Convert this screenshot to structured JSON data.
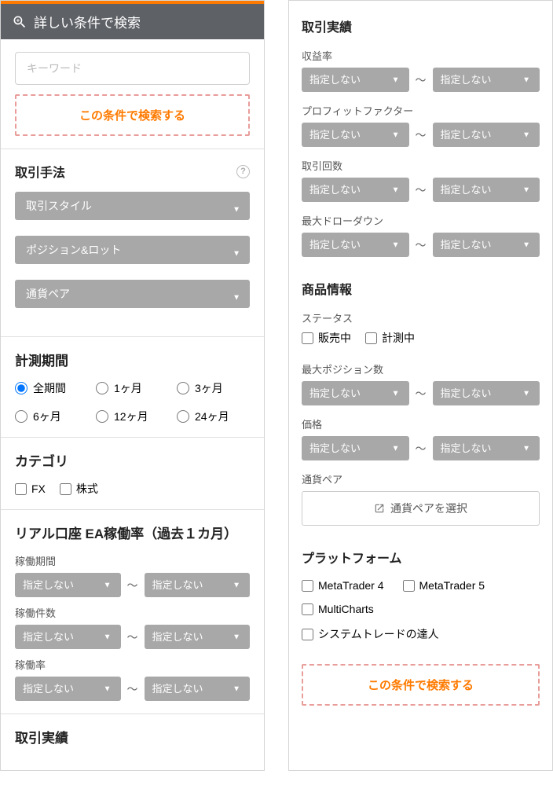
{
  "header": {
    "title": "詳しい条件で検索"
  },
  "keyword": {
    "placeholder": "キーワード"
  },
  "searchBtn": "この条件で検索する",
  "tradingMethod": {
    "title": "取引手法",
    "selects": {
      "style": "取引スタイル",
      "position": "ポジション&ロット",
      "pair": "通貨ペア"
    }
  },
  "period": {
    "title": "計測期間",
    "options": [
      "全期間",
      "1ヶ月",
      "3ヶ月",
      "6ヶ月",
      "12ヶ月",
      "24ヶ月"
    ]
  },
  "category": {
    "title": "カテゴリ",
    "options": [
      "FX",
      "株式"
    ]
  },
  "realAccount": {
    "title": "リアル口座 EA稼働率（過去１カ月）",
    "fields": {
      "period": {
        "label": "稼働期間",
        "opt": "指定しない"
      },
      "count": {
        "label": "稼働件数",
        "opt": "指定しない"
      },
      "rate": {
        "label": "稼働率",
        "opt": "指定しない"
      }
    }
  },
  "results": {
    "title": "取引実績",
    "fields": {
      "profit": {
        "label": "収益率",
        "opt": "指定しない"
      },
      "pf": {
        "label": "プロフィットファクター",
        "opt": "指定しない"
      },
      "trades": {
        "label": "取引回数",
        "opt": "指定しない"
      },
      "dd": {
        "label": "最大ドローダウン",
        "opt": "指定しない"
      }
    }
  },
  "product": {
    "title": "商品情報",
    "status": {
      "label": "ステータス",
      "selling": "販売中",
      "measuring": "計測中"
    },
    "maxPos": {
      "label": "最大ポジション数",
      "opt": "指定しない"
    },
    "price": {
      "label": "価格",
      "opt": "指定しない"
    },
    "pair": {
      "label": "通貨ペア",
      "btn": "通貨ペアを選択"
    }
  },
  "platform": {
    "title": "プラットフォーム",
    "options": [
      "MetaTrader 4",
      "MetaTrader 5",
      "MultiCharts",
      "システムトレードの達人"
    ]
  },
  "tilde": "～"
}
